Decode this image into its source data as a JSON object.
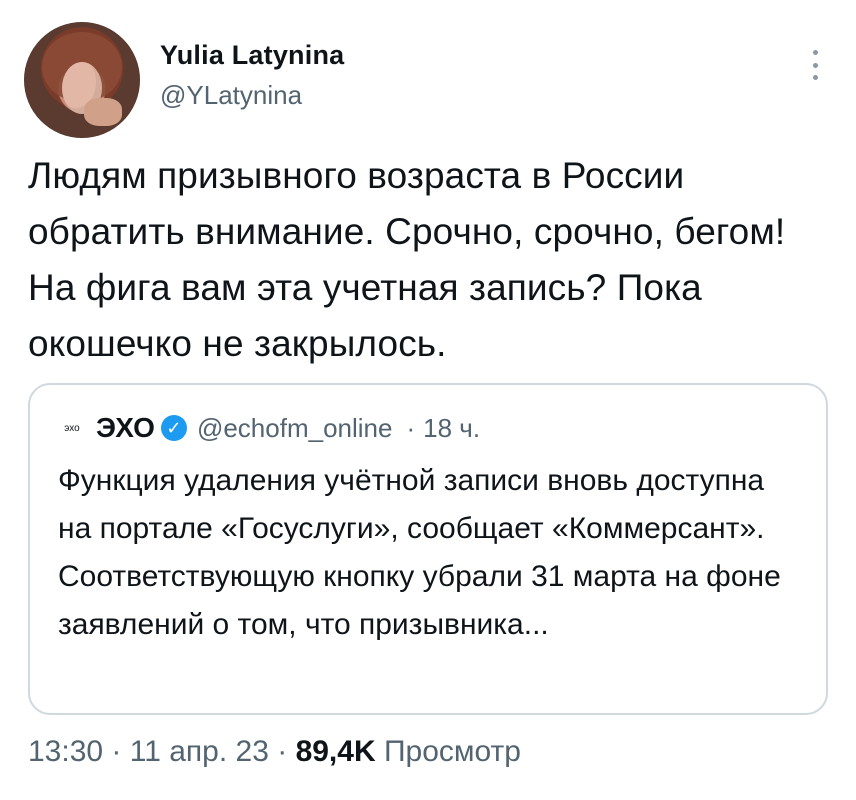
{
  "author": {
    "name": "Yulia Latynina",
    "handle": "@YLatynina"
  },
  "tweet": {
    "text": "Людям призывного возраста в России обратить внимание. Срочно, срочно, бегом! На фига вам эта учетная запись? Пока окошечко не закрылось."
  },
  "quote": {
    "logo_text": "эхо",
    "name": "ЭХО",
    "handle": "@echofm_online",
    "time": "18 ч.",
    "text": "Функция удаления учётной записи вновь доступна на портале «Госуслуги», сообщает «Коммерсант». Соответствующую кнопку убрали 31 марта на фоне заявлений о том, что призывника..."
  },
  "meta": {
    "time": "13:30",
    "date": "11 апр. 23",
    "views": "89,4K",
    "views_label": "Просмотр"
  },
  "colors": {
    "verified": "#1d9bf0",
    "secondary_text": "#536471",
    "border": "#cfd9de"
  },
  "icons": {
    "more": "more-vertical-icon",
    "verified": "verified-badge-icon"
  }
}
